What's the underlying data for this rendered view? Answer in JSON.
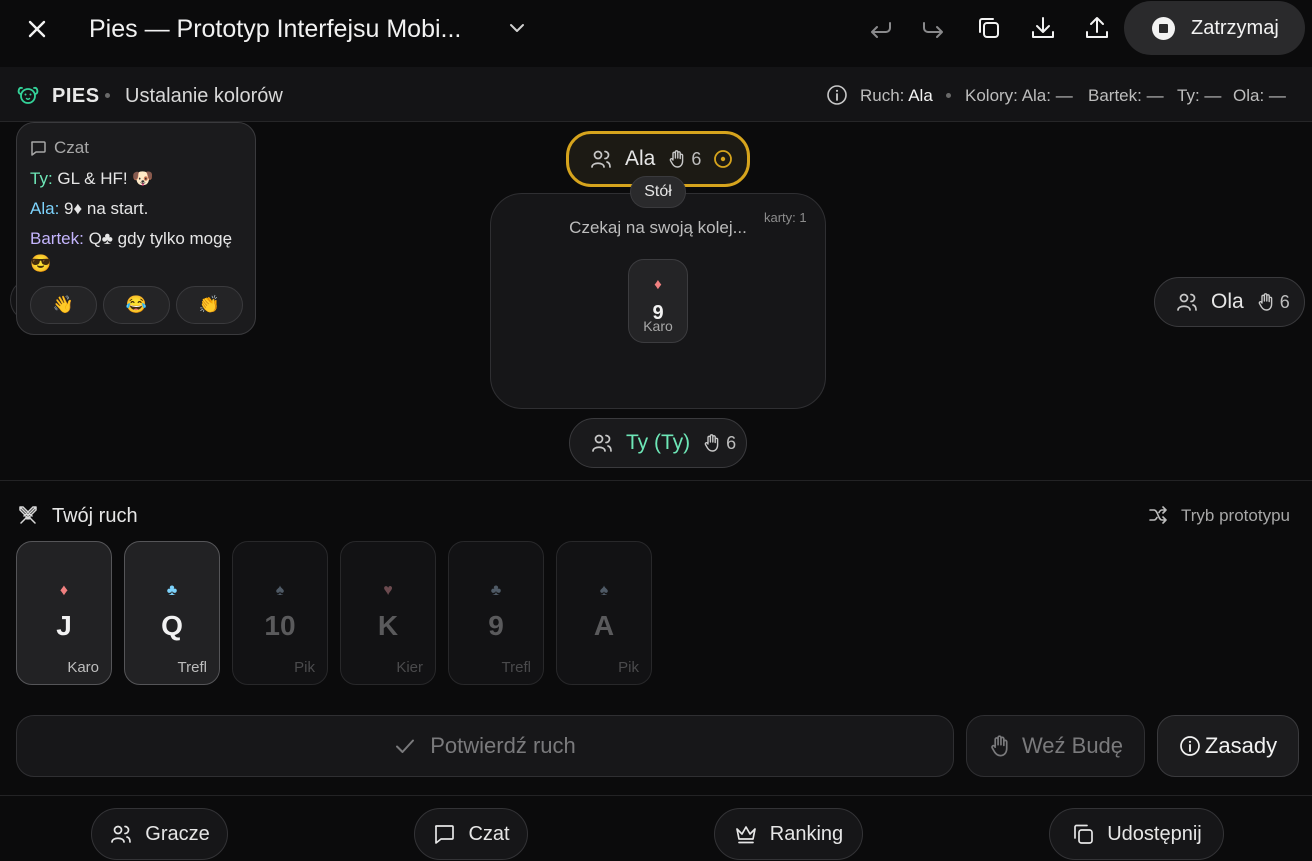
{
  "window": {
    "title": "Pies — Prototyp Interfejsu Mobi...",
    "stop_label": "Zatrzymaj"
  },
  "status": {
    "brand": "PIES",
    "phase": "Ustalanie kolorów",
    "turn_label": "Ruch:",
    "turn_player": "Ala",
    "colors_label": "Kolory: Ala: —",
    "colors_bartek": "Bartek: —",
    "colors_ty": "Ty: —",
    "colors_ola": "Ola: —"
  },
  "table": {
    "label": "Stół",
    "cards_count": "karty: 1",
    "wait_text": "Czekaj na swoją kolej...",
    "top_card": {
      "suit": "♦",
      "rank": "9",
      "suit_name": "Karo"
    },
    "players": [
      {
        "name": "Ala",
        "count": "6",
        "active": true
      },
      {
        "name": "Ola",
        "count": "6",
        "active": false
      },
      {
        "name": "Ty (Ty)",
        "count": "6",
        "active": false
      }
    ]
  },
  "chat": {
    "title": "Czat",
    "messages": [
      {
        "who": "Ty:",
        "text": " GL & HF! 🐶"
      },
      {
        "who": "Ala:",
        "text": " 9♦ na start."
      },
      {
        "who": "Bartek:",
        "text": " Q♣ gdy tylko mogę 😎"
      }
    ],
    "reactions": [
      "👋",
      "😂",
      "👏"
    ]
  },
  "move": {
    "title": "Twój ruch",
    "prototype_label": "Tryb prototypu",
    "hand": [
      {
        "suit": "♦",
        "rank": "J",
        "suit_name": "Karo",
        "playable": true,
        "suit_color": "#f08080"
      },
      {
        "suit": "♣",
        "rank": "Q",
        "suit_name": "Trefl",
        "playable": true,
        "suit_color": "#7dd3fc"
      },
      {
        "suit": "♠",
        "rank": "10",
        "suit_name": "Pik",
        "playable": false,
        "suit_color": "#4f5a66"
      },
      {
        "suit": "♥",
        "rank": "K",
        "suit_name": "Kier",
        "playable": false,
        "suit_color": "#6b4a4f"
      },
      {
        "suit": "♣",
        "rank": "9",
        "suit_name": "Trefl",
        "playable": false,
        "suit_color": "#4f5a66"
      },
      {
        "suit": "♠",
        "rank": "A",
        "suit_name": "Pik",
        "playable": false,
        "suit_color": "#4f5a66"
      }
    ]
  },
  "actions": {
    "confirm": "Potwierdź ruch",
    "take": "Weź Budę",
    "rules": "Zasady"
  },
  "nav": {
    "players": "Gracze",
    "chat": "Czat",
    "ranking": "Ranking",
    "share": "Udostępnij"
  },
  "colors": {
    "accent_gold": "#d6a41d",
    "brand_teal": "#34d399",
    "diamond_red": "#f08080"
  }
}
